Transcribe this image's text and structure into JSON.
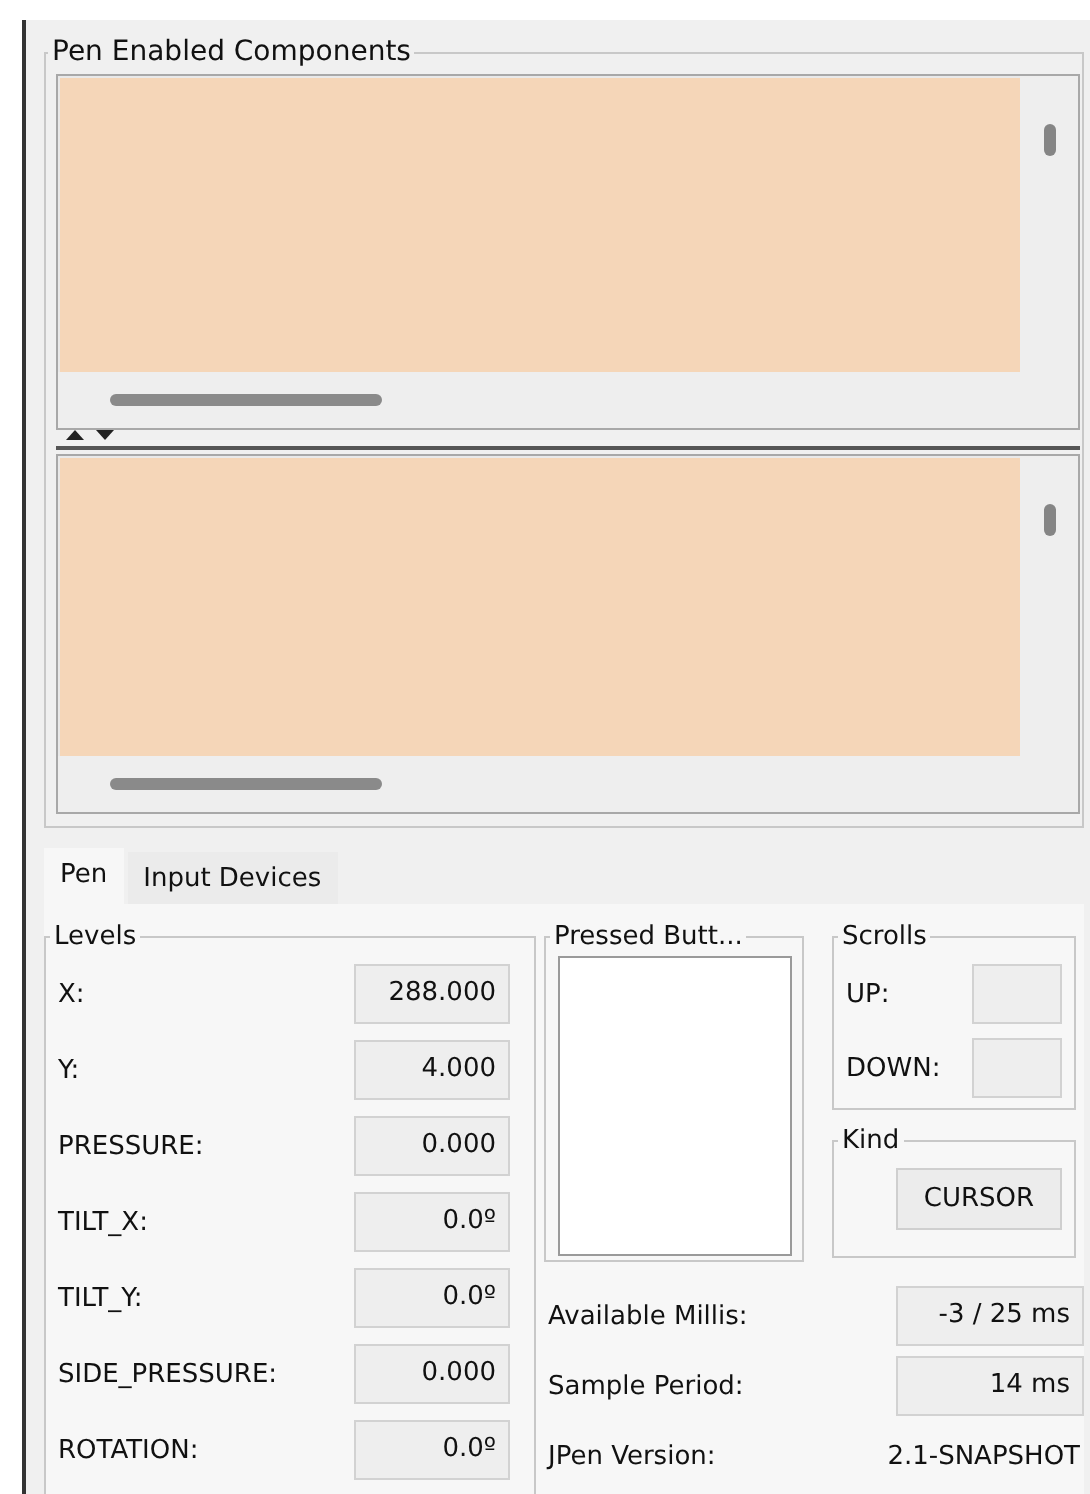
{
  "components": {
    "title": "Pen Enabled Components"
  },
  "tabs": [
    {
      "label": "Pen",
      "selected": true
    },
    {
      "label": "Input Devices",
      "selected": false
    }
  ],
  "levels": {
    "title": "Levels",
    "rows": [
      {
        "label": "X:",
        "value": "288.000"
      },
      {
        "label": "Y:",
        "value": "4.000"
      },
      {
        "label": "PRESSURE:",
        "value": "0.000"
      },
      {
        "label": "TILT_X:",
        "value": "0.0º"
      },
      {
        "label": "TILT_Y:",
        "value": "0.0º"
      },
      {
        "label": "SIDE_PRESSURE:",
        "value": "0.000"
      },
      {
        "label": "ROTATION:",
        "value": "0.0º"
      }
    ]
  },
  "pressed_buttons": {
    "title": "Pressed Butt..."
  },
  "scrolls": {
    "title": "Scrolls",
    "rows": [
      {
        "label": "UP:"
      },
      {
        "label": "DOWN:"
      }
    ]
  },
  "kind": {
    "title": "Kind",
    "value": "CURSOR"
  },
  "info": [
    {
      "kind": "field",
      "label": "Available Millis:",
      "value": "-3 / 25 ms"
    },
    {
      "kind": "field",
      "label": "Sample Period:",
      "value": "14 ms"
    },
    {
      "kind": "text",
      "label": "JPen Version:",
      "value": "2.1-SNAPSHOT"
    }
  ]
}
